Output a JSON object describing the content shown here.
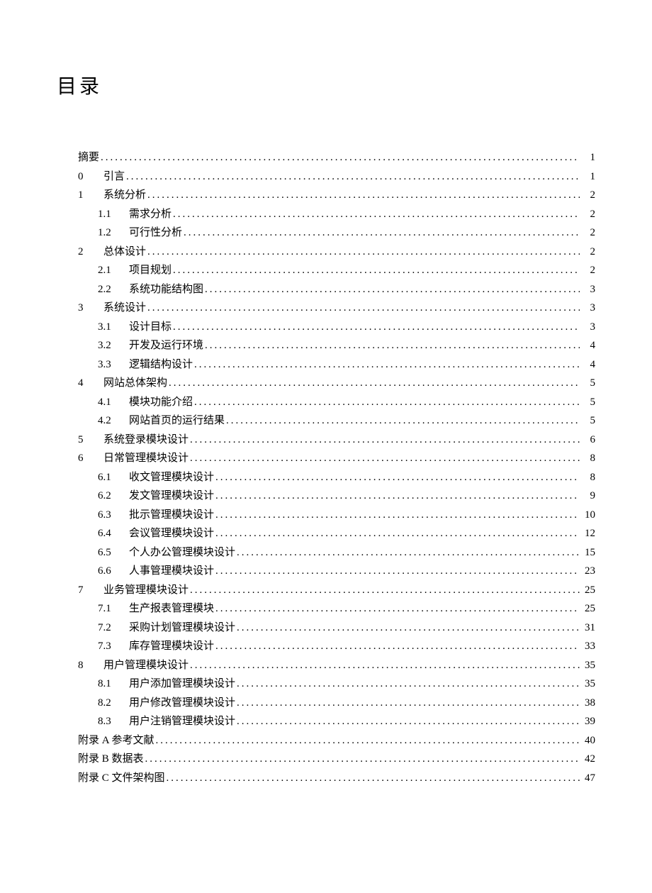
{
  "title": "目录",
  "entries": [
    {
      "indent": 0,
      "num": "",
      "label": "摘要",
      "page": "1",
      "space": false
    },
    {
      "indent": 0,
      "num": "0",
      "label": "引言",
      "page": "1",
      "space": true
    },
    {
      "indent": 0,
      "num": "1",
      "label": "系统分析",
      "page": "2",
      "space": true
    },
    {
      "indent": 1,
      "num": "1.1",
      "label": "需求分析",
      "page": "2",
      "space": true
    },
    {
      "indent": 1,
      "num": "1.2",
      "label": "可行性分析",
      "page": "2",
      "space": true
    },
    {
      "indent": 0,
      "num": "2",
      "label": "总体设计",
      "page": "2",
      "space": true
    },
    {
      "indent": 1,
      "num": "2.1",
      "label": "项目规划",
      "page": "2",
      "space": true
    },
    {
      "indent": 1,
      "num": "2.2",
      "label": "系统功能结构图",
      "page": "3",
      "space": true
    },
    {
      "indent": 0,
      "num": "3",
      "label": "系统设计",
      "page": "3",
      "space": true
    },
    {
      "indent": 1,
      "num": "3.1",
      "label": "设计目标",
      "page": "3",
      "space": true
    },
    {
      "indent": 1,
      "num": "3.2",
      "label": "开发及运行环境",
      "page": "4",
      "space": true
    },
    {
      "indent": 1,
      "num": "3.3",
      "label": "逻辑结构设计",
      "page": "4",
      "space": true
    },
    {
      "indent": 0,
      "num": "4",
      "label": "网站总体架构",
      "page": "5",
      "space": true
    },
    {
      "indent": 1,
      "num": "4.1",
      "label": "模块功能介绍",
      "page": "5",
      "space": true
    },
    {
      "indent": 1,
      "num": "4.2",
      "label": "网站首页的运行结果",
      "page": "5",
      "space": true
    },
    {
      "indent": 0,
      "num": "5",
      "label": "系统登录模块设计",
      "page": "6",
      "space": true
    },
    {
      "indent": 0,
      "num": "6",
      "label": "日常管理模块设计",
      "page": "8",
      "space": false
    },
    {
      "indent": 1,
      "num": "6.1",
      "label": "收文管理模块设计",
      "page": "8",
      "space": true
    },
    {
      "indent": 1,
      "num": "6.2",
      "label": "发文管理模块设计",
      "page": "9",
      "space": true
    },
    {
      "indent": 1,
      "num": "6.3",
      "label": "批示管理模块设计",
      "page": "10",
      "space": true
    },
    {
      "indent": 1,
      "num": "6.4",
      "label": "会议管理模块设计",
      "page": "12",
      "space": true
    },
    {
      "indent": 1,
      "num": "6.5",
      "label": "个人办公管理模块设计",
      "page": "15",
      "space": true
    },
    {
      "indent": 1,
      "num": "6.6",
      "label": "人事管理模块设计",
      "page": "23",
      "space": true
    },
    {
      "indent": 0,
      "num": "7",
      "label": "业务管理模块设计",
      "page": "25",
      "space": false
    },
    {
      "indent": 1,
      "num": "7.1",
      "label": "生产报表管理模块",
      "page": "25",
      "space": true
    },
    {
      "indent": 1,
      "num": "7.2",
      "label": "采购计划管理模块设计",
      "page": "31",
      "space": true
    },
    {
      "indent": 1,
      "num": "7.3",
      "label": "库存管理模块设计",
      "page": "33",
      "space": true
    },
    {
      "indent": 0,
      "num": "8",
      "label": "用户管理模块设计",
      "page": "35",
      "space": true
    },
    {
      "indent": 1,
      "num": "8.1",
      "label": "用户添加管理模块设计",
      "page": "35",
      "space": true
    },
    {
      "indent": 1,
      "num": "8.2",
      "label": "用户修改管理模块设计",
      "page": "38",
      "space": true
    },
    {
      "indent": 1,
      "num": "8.3",
      "label": "用户注销管理模块设计",
      "page": "39",
      "space": true
    },
    {
      "indent": 0,
      "num": "附录 A",
      "label": "参考文献",
      "page": "40",
      "space": true,
      "appendix": true
    },
    {
      "indent": 0,
      "num": "附录 B",
      "label": "数据表",
      "page": "42",
      "space": true,
      "appendix": true
    },
    {
      "indent": 0,
      "num": "附录 C",
      "label": "文件架构图",
      "page": "47",
      "space": true,
      "appendix": true
    }
  ]
}
